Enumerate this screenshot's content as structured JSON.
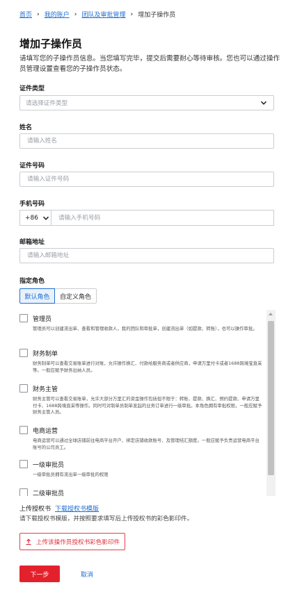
{
  "breadcrumb": {
    "items": [
      "首页",
      "我的账户",
      "团队及审批管理"
    ],
    "current": "增加子操作员"
  },
  "title": "增加子操作员",
  "intro": "请填写您的子操作员信息。当您填写完毕，提交后需要耐心等待审核。您也可以通过操作员管理设置查看您的子操作员状态。",
  "id_type": {
    "label": "证件类型",
    "placeholder": "请选择证件类型"
  },
  "name": {
    "label": "姓名",
    "placeholder": "请输入姓名"
  },
  "id_number": {
    "label": "证件号码",
    "placeholder": "请输入证件号码"
  },
  "phone": {
    "label": "手机号码",
    "country_code": "+86",
    "placeholder": "请输入手机号码"
  },
  "email": {
    "label": "邮箱地址",
    "placeholder": "请输入邮箱地址"
  },
  "role_section": {
    "label": "指定角色",
    "tabs": [
      "默认角色",
      "自定义角色"
    ],
    "active_tab": 0,
    "roles": [
      {
        "title": "管理员",
        "desc": "管理员可以创建流出单、查看和管理收款人，我的团队和审批单，创建流出单（如提款、转账），也可以操作审批。"
      },
      {
        "title": "财务制单",
        "desc": "财务制单可以查看交易账单进行对账，允许操作换汇、付款给服务商或者供应商，申请万里付卡或者1688跨境宝直采等。一般应赋予财务出纳人员。"
      },
      {
        "title": "财务主管",
        "desc": "财务主管可以查看交易账单，允许大部分万里汇的资金操作包括但不限于：转账、提款、换汇、预约提款、申请万里付卡、1688跨境直采等操作。同时可对制单员制单发起的业务订单进行一级审批。本角色拥有审批权限，一般应赋予财务主管人员。"
      },
      {
        "title": "电商运营",
        "desc": "电商运营可以通过全球店铺前往电商平台开户、绑定店铺收款账号、及管理结汇额度。一般应赋予负责运营电商平台账号的公司员工。"
      },
      {
        "title": "一级审批员",
        "desc": "一级审批员拥有流出单一级审批的权限"
      },
      {
        "title": "二级审批员",
        "desc": ""
      }
    ]
  },
  "upload": {
    "label": "上传授权书",
    "template_link": "下载授权书模版",
    "hint": "请下载授权书模版，并按照要求填写后上传授权书的彩色影印件。",
    "button": "上传该操作员授权书彩色影印件"
  },
  "actions": {
    "next": "下一步",
    "cancel": "取消"
  },
  "colors": {
    "accent": "#1f6fd1",
    "primary_button": "#e3212d"
  }
}
